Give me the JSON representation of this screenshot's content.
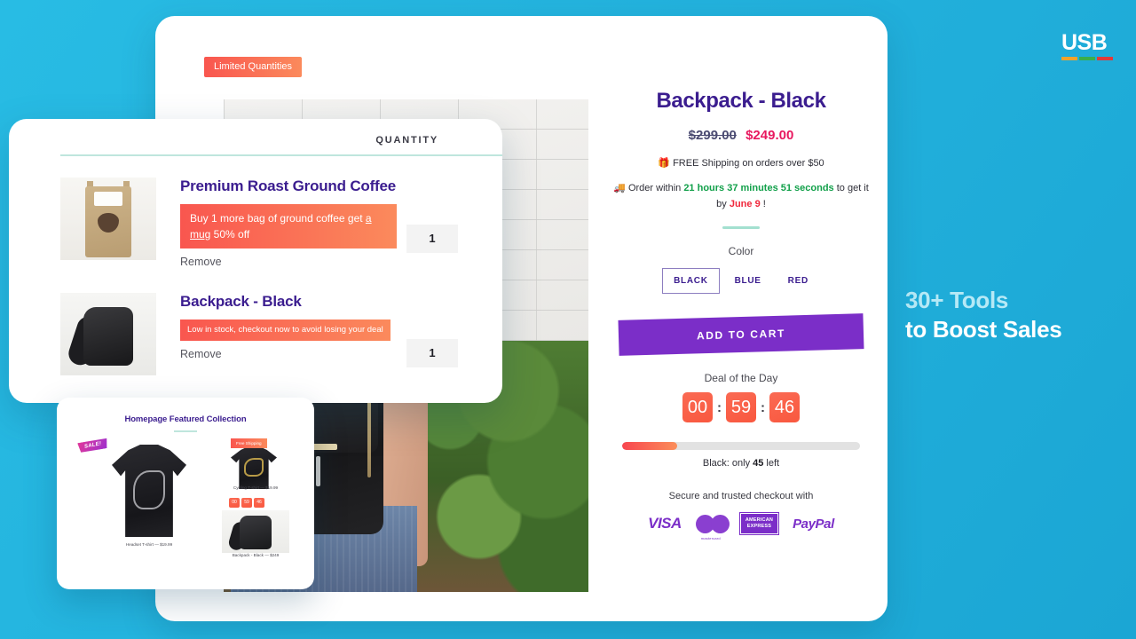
{
  "brand": {
    "wordmark": "USB",
    "bar_colors": [
      "#f0a32a",
      "#3aae4a",
      "#e03a3a"
    ]
  },
  "headline": {
    "line1": "30+ Tools",
    "line2": "to Boost Sales",
    "line1_color": "#b6e9f6",
    "line2_color": "#ffffff"
  },
  "gallery": {
    "badge": "Limited Quantities"
  },
  "product": {
    "title": "Backpack - Black",
    "price_old": "$299.00",
    "price_new": "$249.00",
    "shipping_icon": "🎁",
    "shipping_text": "FREE Shipping on orders over $50",
    "truck_icon": "🚚",
    "order_prefix": "Order within ",
    "order_countdown": "21 hours 37 minutes 51 seconds",
    "order_middle": " to get it by ",
    "order_date": "June 9",
    "order_suffix": " !",
    "color_label": "Color",
    "colors": [
      {
        "label": "BLACK",
        "selected": true
      },
      {
        "label": "BLUE",
        "selected": false
      },
      {
        "label": "RED",
        "selected": false
      }
    ],
    "add_to_cart": "ADD TO CART",
    "accent_purple": "#7b2ec8"
  },
  "deal": {
    "label": "Deal of the Day",
    "hours": "00",
    "minutes": "59",
    "seconds": "46",
    "separator": ":",
    "block_color": "#f9583f"
  },
  "stock": {
    "percent": 23,
    "prefix": "Black: only ",
    "count": "45",
    "suffix": " left"
  },
  "checkout": {
    "secure_text": "Secure and trusted checkout with",
    "methods": [
      {
        "name": "visa-icon",
        "label": "VISA"
      },
      {
        "name": "mastercard-icon",
        "label": "mastercard"
      },
      {
        "name": "amex-icon",
        "label": "AMERICAN EXPRESS"
      },
      {
        "name": "paypal-icon",
        "label": "PayPal"
      }
    ],
    "amex_line1": "AMERICAN",
    "amex_line2": "EXPRESS",
    "mc_caption": "mastercard"
  },
  "cart": {
    "quantity_header": "QUANTITY",
    "items": [
      {
        "name": "Premium Roast Ground Coffee",
        "promo_pre": "Buy 1 more bag of ground coffee get ",
        "promo_link": "a mug",
        "promo_post": " 50% off",
        "remove": "Remove",
        "qty": "1"
      },
      {
        "name": "Backpack - Black",
        "promo": "Low in stock, checkout now to avoid losing your deal",
        "remove": "Remove",
        "qty": "1"
      }
    ]
  },
  "featured": {
    "title": "Homepage Featured Collection",
    "sale_badge": "SALE!",
    "free_shipping_badge": "Free Shipping",
    "items": [
      {
        "label": "Headset T-shirt — $19.99"
      },
      {
        "label": "Cycling T-shirt — $19.99"
      },
      {
        "label": "Backpack - Black — $249"
      }
    ],
    "mini_timer": [
      "00",
      "59",
      "46"
    ]
  }
}
